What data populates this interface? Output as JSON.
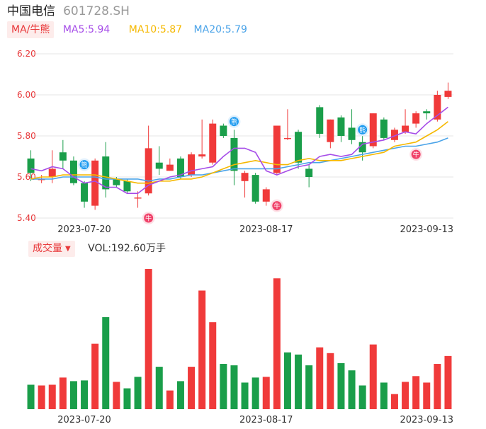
{
  "header": {
    "name": "中国电信",
    "code": "601728.SH"
  },
  "legend": {
    "ma_tag": "MA/牛熊",
    "ma5": {
      "text": "MA5:5.94",
      "color": "#a64de8"
    },
    "ma10": {
      "text": "MA10:5.87",
      "color": "#f5b800"
    },
    "ma20": {
      "text": "MA20:5.79",
      "color": "#4aa3e8"
    }
  },
  "volume_legend": {
    "tag": "成交量",
    "caret": "▼",
    "vol": "VOL:192.60万手"
  },
  "colors": {
    "up": "#f03a3a",
    "down": "#1a9e4a",
    "grid": "#e6e6e6",
    "axis_label": "#e8383a"
  },
  "chart_data": [
    {
      "type": "candlestick",
      "yticks": [
        6.2,
        6.0,
        5.8,
        5.6,
        5.4
      ],
      "ylim": [
        5.4,
        6.2
      ],
      "xticks": [
        "2023-07-20",
        "2023-08-17",
        "2023-09-13"
      ],
      "xtick_index": [
        5,
        22,
        37
      ],
      "candles": [
        {
          "o": 5.69,
          "c": 5.62,
          "h": 5.73,
          "l": 5.58
        },
        {
          "o": 5.59,
          "c": 5.59,
          "h": 5.61,
          "l": 5.57
        },
        {
          "o": 5.6,
          "c": 5.64,
          "h": 5.73,
          "l": 5.57
        },
        {
          "o": 5.72,
          "c": 5.68,
          "h": 5.78,
          "l": 5.64
        },
        {
          "o": 5.68,
          "c": 5.57,
          "h": 5.7,
          "l": 5.56
        },
        {
          "o": 5.57,
          "c": 5.48,
          "h": 5.58,
          "l": 5.45
        },
        {
          "o": 5.46,
          "c": 5.68,
          "h": 5.69,
          "l": 5.44
        },
        {
          "o": 5.7,
          "c": 5.54,
          "h": 5.77,
          "l": 5.5
        },
        {
          "o": 5.59,
          "c": 5.56,
          "h": 5.6,
          "l": 5.55
        },
        {
          "o": 5.58,
          "c": 5.53,
          "h": 5.59,
          "l": 5.52
        },
        {
          "o": 5.5,
          "c": 5.5,
          "h": 5.53,
          "l": 5.45
        },
        {
          "o": 5.52,
          "c": 5.74,
          "h": 5.85,
          "l": 5.51
        },
        {
          "o": 5.67,
          "c": 5.64,
          "h": 5.75,
          "l": 5.61
        },
        {
          "o": 5.63,
          "c": 5.66,
          "h": 5.69,
          "l": 5.63
        },
        {
          "o": 5.69,
          "c": 5.6,
          "h": 5.7,
          "l": 5.59
        },
        {
          "o": 5.61,
          "c": 5.71,
          "h": 5.72,
          "l": 5.6
        },
        {
          "o": 5.7,
          "c": 5.71,
          "h": 5.88,
          "l": 5.69
        },
        {
          "o": 5.67,
          "c": 5.86,
          "h": 5.88,
          "l": 5.66
        },
        {
          "o": 5.85,
          "c": 5.8,
          "h": 5.86,
          "l": 5.79
        },
        {
          "o": 5.79,
          "c": 5.63,
          "h": 5.83,
          "l": 5.56
        },
        {
          "o": 5.58,
          "c": 5.62,
          "h": 5.63,
          "l": 5.5
        },
        {
          "o": 5.61,
          "c": 5.48,
          "h": 5.62,
          "l": 5.47
        },
        {
          "o": 5.48,
          "c": 5.54,
          "h": 5.55,
          "l": 5.46
        },
        {
          "o": 5.62,
          "c": 5.85,
          "h": 5.85,
          "l": 5.61
        },
        {
          "o": 5.79,
          "c": 5.79,
          "h": 5.93,
          "l": 5.78
        },
        {
          "o": 5.82,
          "c": 5.67,
          "h": 5.83,
          "l": 5.64
        },
        {
          "o": 5.64,
          "c": 5.6,
          "h": 5.66,
          "l": 5.55
        },
        {
          "o": 5.94,
          "c": 5.81,
          "h": 5.95,
          "l": 5.79
        },
        {
          "o": 5.77,
          "c": 5.88,
          "h": 5.88,
          "l": 5.74
        },
        {
          "o": 5.89,
          "c": 5.8,
          "h": 5.9,
          "l": 5.77
        },
        {
          "o": 5.84,
          "c": 5.78,
          "h": 5.93,
          "l": 5.76
        },
        {
          "o": 5.77,
          "c": 5.72,
          "h": 5.83,
          "l": 5.68
        },
        {
          "o": 5.75,
          "c": 5.91,
          "h": 5.91,
          "l": 5.74
        },
        {
          "o": 5.88,
          "c": 5.79,
          "h": 5.89,
          "l": 5.78
        },
        {
          "o": 5.78,
          "c": 5.83,
          "h": 5.84,
          "l": 5.77
        },
        {
          "o": 5.82,
          "c": 5.85,
          "h": 5.93,
          "l": 5.81
        },
        {
          "o": 5.86,
          "c": 5.91,
          "h": 5.92,
          "l": 5.84
        },
        {
          "o": 5.92,
          "c": 5.91,
          "h": 5.93,
          "l": 5.88
        },
        {
          "o": 5.88,
          "c": 6.0,
          "h": 6.02,
          "l": 5.87
        },
        {
          "o": 5.99,
          "c": 6.02,
          "h": 6.06,
          "l": 5.98
        }
      ],
      "ma5": [
        5.64,
        5.63,
        5.65,
        5.64,
        5.6,
        5.57,
        5.58,
        5.55,
        5.55,
        5.52,
        5.52,
        5.56,
        5.58,
        5.6,
        5.61,
        5.63,
        5.64,
        5.65,
        5.7,
        5.74,
        5.74,
        5.72,
        5.63,
        5.61,
        5.63,
        5.65,
        5.66,
        5.7,
        5.71,
        5.7,
        5.71,
        5.76,
        5.77,
        5.78,
        5.8,
        5.82,
        5.81,
        5.86,
        5.9,
        5.94
      ],
      "ma10": [
        5.59,
        5.6,
        5.6,
        5.61,
        5.61,
        5.61,
        5.61,
        5.6,
        5.59,
        5.58,
        5.57,
        5.57,
        5.58,
        5.58,
        5.59,
        5.59,
        5.6,
        5.62,
        5.64,
        5.66,
        5.67,
        5.68,
        5.67,
        5.66,
        5.66,
        5.68,
        5.69,
        5.68,
        5.68,
        5.68,
        5.69,
        5.7,
        5.71,
        5.72,
        5.75,
        5.76,
        5.77,
        5.8,
        5.83,
        5.87
      ],
      "ma20": [
        5.59,
        5.59,
        5.59,
        5.6,
        5.6,
        5.6,
        5.6,
        5.59,
        5.59,
        5.59,
        5.59,
        5.58,
        5.59,
        5.59,
        5.6,
        5.61,
        5.61,
        5.62,
        5.63,
        5.64,
        5.64,
        5.64,
        5.64,
        5.64,
        5.65,
        5.66,
        5.67,
        5.67,
        5.68,
        5.69,
        5.7,
        5.71,
        5.72,
        5.73,
        5.74,
        5.75,
        5.75,
        5.76,
        5.77,
        5.79
      ],
      "signals": [
        {
          "label": "熊",
          "index": 5,
          "price": 5.66,
          "kind": "bear"
        },
        {
          "label": "牛",
          "index": 11,
          "price": 5.4,
          "kind": "bull"
        },
        {
          "label": "熊",
          "index": 19,
          "price": 5.87,
          "kind": "bear"
        },
        {
          "label": "牛",
          "index": 23,
          "price": 5.46,
          "kind": "bull"
        },
        {
          "label": "熊",
          "index": 31,
          "price": 5.83,
          "kind": "bear"
        },
        {
          "label": "牛",
          "index": 36,
          "price": 5.71,
          "kind": "bull"
        }
      ]
    },
    {
      "type": "bar",
      "name": "成交量",
      "xticks": [
        "2023-07-20",
        "2023-08-17",
        "2023-09-13"
      ],
      "volumes": [
        {
          "v": 34,
          "up": false
        },
        {
          "v": 33,
          "up": true
        },
        {
          "v": 34,
          "up": true
        },
        {
          "v": 44,
          "up": true
        },
        {
          "v": 39,
          "up": false
        },
        {
          "v": 40,
          "up": false
        },
        {
          "v": 91,
          "up": true
        },
        {
          "v": 128,
          "up": false
        },
        {
          "v": 38,
          "up": true
        },
        {
          "v": 29,
          "up": false
        },
        {
          "v": 45,
          "up": false
        },
        {
          "v": 195,
          "up": true
        },
        {
          "v": 59,
          "up": false
        },
        {
          "v": 26,
          "up": true
        },
        {
          "v": 39,
          "up": false
        },
        {
          "v": 59,
          "up": true
        },
        {
          "v": 165,
          "up": true
        },
        {
          "v": 121,
          "up": true
        },
        {
          "v": 63,
          "up": false
        },
        {
          "v": 61,
          "up": false
        },
        {
          "v": 37,
          "up": false
        },
        {
          "v": 44,
          "up": false
        },
        {
          "v": 45,
          "up": true
        },
        {
          "v": 182,
          "up": true
        },
        {
          "v": 79,
          "up": false
        },
        {
          "v": 76,
          "up": false
        },
        {
          "v": 61,
          "up": false
        },
        {
          "v": 86,
          "up": true
        },
        {
          "v": 78,
          "up": true
        },
        {
          "v": 64,
          "up": false
        },
        {
          "v": 54,
          "up": false
        },
        {
          "v": 33,
          "up": false
        },
        {
          "v": 90,
          "up": true
        },
        {
          "v": 37,
          "up": false
        },
        {
          "v": 21,
          "up": true
        },
        {
          "v": 38,
          "up": true
        },
        {
          "v": 46,
          "up": true
        },
        {
          "v": 37,
          "up": true
        },
        {
          "v": 63,
          "up": true
        },
        {
          "v": 74,
          "up": true
        }
      ]
    }
  ]
}
